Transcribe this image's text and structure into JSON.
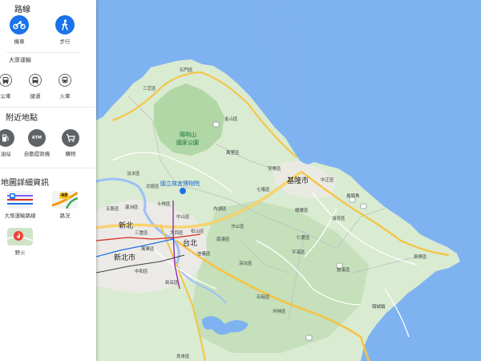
{
  "panel": {
    "route": {
      "title": "路線",
      "items": [
        {
          "label": "機車",
          "icon": "motorcycle-icon"
        },
        {
          "label": "步行",
          "icon": "walking-icon"
        }
      ]
    },
    "transit": {
      "title": "大眾運輸",
      "items": [
        {
          "label": "公車",
          "icon": "bus-icon"
        },
        {
          "label": "捷運",
          "icon": "metro-icon"
        },
        {
          "label": "火車",
          "icon": "train-icon"
        }
      ]
    },
    "nearby": {
      "title": "附近地點",
      "items": [
        {
          "label": "油站",
          "icon": "gas-station-icon"
        },
        {
          "label": "自動提款機",
          "icon": "atm-icon",
          "badge": "ATM"
        },
        {
          "label": "購物",
          "icon": "shopping-cart-icon"
        }
      ]
    },
    "details": {
      "title": "地圖詳細資訊",
      "items": [
        {
          "label": "大眾運輸路線",
          "icon": "transit-layer-icon"
        },
        {
          "label": "路況",
          "icon": "traffic-layer-icon",
          "badge": "48"
        },
        {
          "label": "野火",
          "icon": "wildfire-layer-icon"
        }
      ]
    }
  },
  "map": {
    "colors": {
      "water": "#7fb2f0",
      "land": "#d9ebd1",
      "mountain": "#a9d3a0",
      "highway": "#f6c343",
      "road": "#ffffff",
      "urban": "#eceae6"
    },
    "cities": [
      "基隆市",
      "新北市",
      "台北"
    ],
    "labels": {
      "park_title": "陽明山",
      "park_sub": "國家公園",
      "museum": "國立故宮博物院",
      "xinbei_top": "新北",
      "towns": [
        "石門區",
        "三芝區",
        "金山區",
        "萬里區",
        "淡水區",
        "北投區",
        "士林區",
        "五股區",
        "蘆洲區",
        "三重區",
        "中山區",
        "松山區",
        "內湖區",
        "汐止區",
        "大同區",
        "萬華區",
        "中和區",
        "信義區",
        "南港區",
        "新店區",
        "深坑區",
        "石碇區",
        "平溪區",
        "瑞芳區",
        "貢寮區",
        "雙溪區",
        "七堵區",
        "暖暖區",
        "安樂區",
        "中正區",
        "仁愛區",
        "坪林區",
        "烏來區",
        "鼻頭角",
        "頭城鎮"
      ]
    }
  }
}
